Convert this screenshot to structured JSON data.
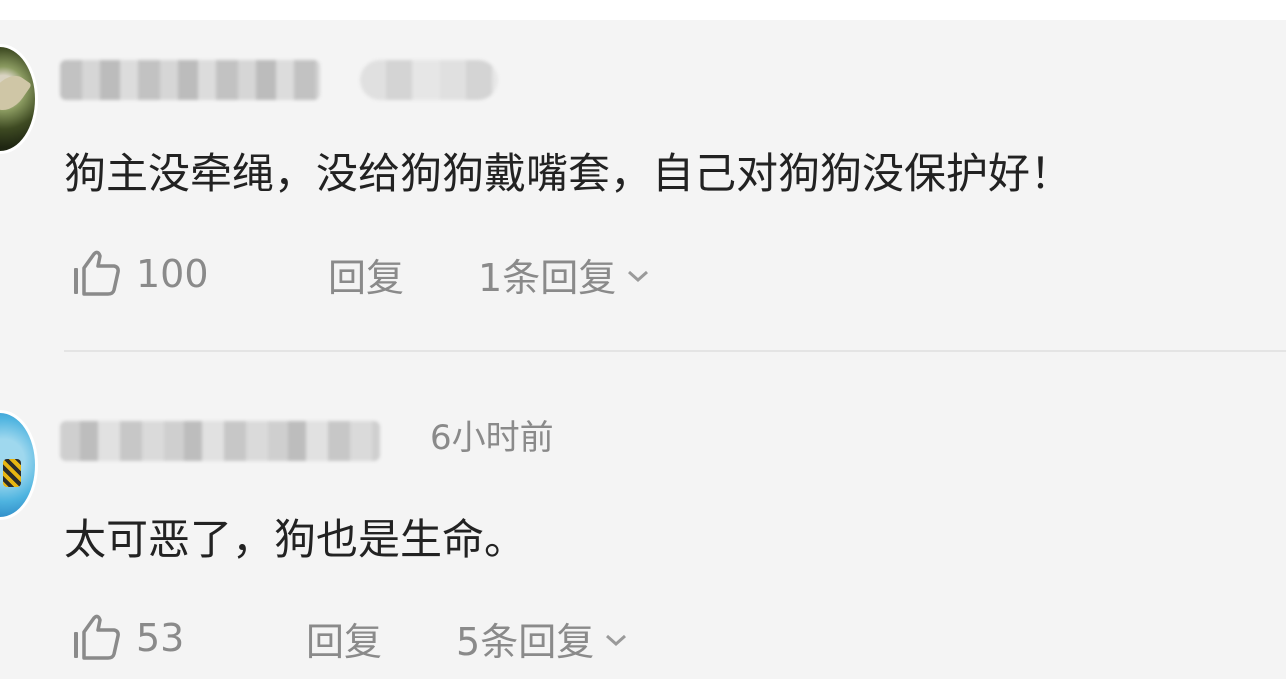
{
  "comments": [
    {
      "content": "狗主没牵绳，没给狗狗戴嘴套，自己对狗狗没保护好！",
      "like_count": "100",
      "reply_label": "回复",
      "replies_label": "1条回复"
    },
    {
      "time": "6小时前",
      "content": "太可恶了，狗也是生命。",
      "like_count": "53",
      "reply_label": "回复",
      "replies_label": "5条回复"
    }
  ],
  "icons": {
    "like": "thumbs-up-outline-icon",
    "expand": "chevron-down-icon"
  },
  "colors": {
    "panel_bg": "#f4f4f4",
    "text_primary": "#222222",
    "text_secondary": "#8a8a8a"
  }
}
